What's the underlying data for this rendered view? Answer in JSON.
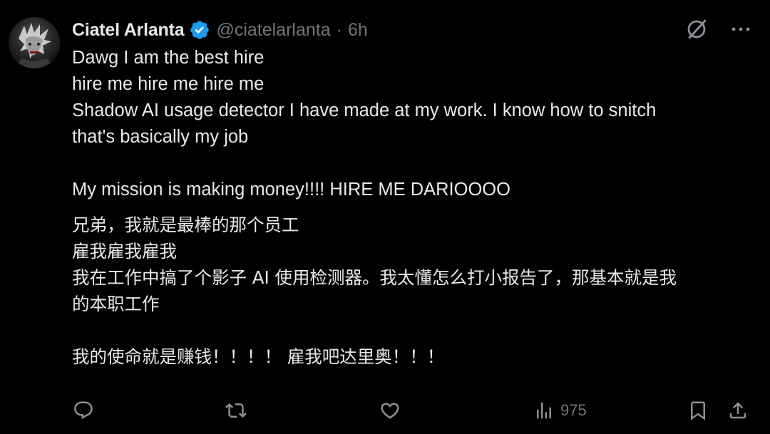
{
  "tweet": {
    "author": {
      "display_name": "Ciatel Arlanta",
      "handle": "@ciatelarlanta",
      "verified": true,
      "avatar_icon": "avatar-icon"
    },
    "separator": "·",
    "time": "6h",
    "text_lines": {
      "en1": "Dawg I am the best hire",
      "en2": "hire me hire me hire me",
      "en3": "Shadow AI usage detector I have made at my work. I know how to snitch",
      "en4": "that's basically my job",
      "en5": "My mission is making money!!!! HIRE ME DARIOOOO",
      "zh1": "兄弟，我就是最棒的那个员工",
      "zh2": "雇我雇我雇我",
      "zh3": "我在工作中搞了个影子 AI 使用检测器。我太懂怎么打小报告了，那基本就是我",
      "zh4": "的本职工作",
      "zh5": "我的使命就是赚钱！！！！ 雇我吧达里奥！！！"
    },
    "actions": {
      "reply_icon": "reply-icon",
      "retweet_icon": "retweet-icon",
      "like_icon": "heart-icon",
      "views_icon": "views-icon",
      "views_count": "975",
      "bookmark_icon": "bookmark-icon",
      "share_icon": "share-icon"
    },
    "top_icons": {
      "grok_icon": "grok-icon",
      "more_icon": "more-icon"
    },
    "colors": {
      "background": "#000000",
      "text": "#e7e9ea",
      "muted": "#71767b",
      "verified": "#1d9bf0"
    }
  }
}
